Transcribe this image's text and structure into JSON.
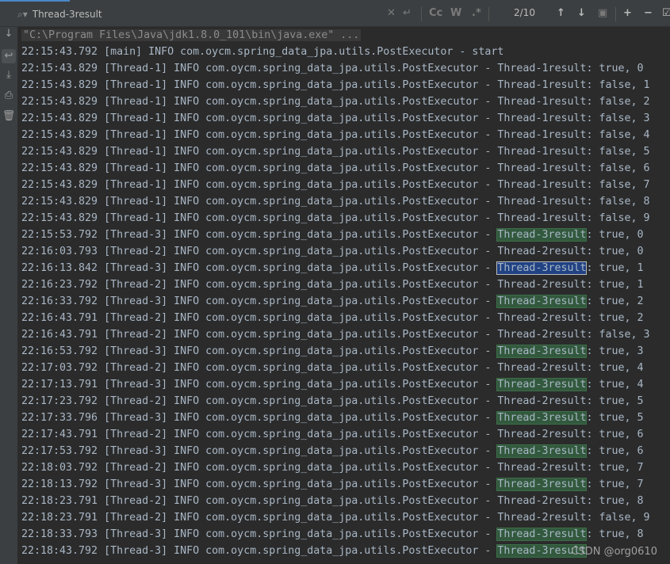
{
  "search": {
    "query": "Thread-3result",
    "match_counter": "2/10",
    "case_label": "Cc",
    "word_label": "W",
    "regex_label": ".*"
  },
  "icons": {
    "search": "search-icon",
    "clear": "close-icon",
    "newline": "enter-icon",
    "up": "arrow-up-icon",
    "down": "arrow-down-icon",
    "select": "select-all-icon",
    "add": "add-occurrence-icon",
    "remove": "remove-occurrence-icon",
    "filter": "filter-icon"
  },
  "colors": {
    "background": "#2b2b2b",
    "text": "#a9b7c6",
    "match": "#32593d",
    "current_match": "#214283"
  },
  "console": {
    "command": "\"C:\\Program Files\\Java\\jdk1.8.0_101\\bin\\java.exe\" ...",
    "lines": [
      {
        "pre": "22:15:43.792 [main] INFO com.oycm.spring_data_jpa.utils.PostExecutor - start",
        "key": "",
        "post": "",
        "mark": ""
      },
      {
        "pre": "22:15:43.829 [Thread-1] INFO com.oycm.spring_data_jpa.utils.PostExecutor - ",
        "key": "Thread-1result",
        "post": ": true, 0",
        "mark": ""
      },
      {
        "pre": "22:15:43.829 [Thread-1] INFO com.oycm.spring_data_jpa.utils.PostExecutor - ",
        "key": "Thread-1result",
        "post": ": false, 1",
        "mark": ""
      },
      {
        "pre": "22:15:43.829 [Thread-1] INFO com.oycm.spring_data_jpa.utils.PostExecutor - ",
        "key": "Thread-1result",
        "post": ": false, 2",
        "mark": ""
      },
      {
        "pre": "22:15:43.829 [Thread-1] INFO com.oycm.spring_data_jpa.utils.PostExecutor - ",
        "key": "Thread-1result",
        "post": ": false, 3",
        "mark": ""
      },
      {
        "pre": "22:15:43.829 [Thread-1] INFO com.oycm.spring_data_jpa.utils.PostExecutor - ",
        "key": "Thread-1result",
        "post": ": false, 4",
        "mark": ""
      },
      {
        "pre": "22:15:43.829 [Thread-1] INFO com.oycm.spring_data_jpa.utils.PostExecutor - ",
        "key": "Thread-1result",
        "post": ": false, 5",
        "mark": ""
      },
      {
        "pre": "22:15:43.829 [Thread-1] INFO com.oycm.spring_data_jpa.utils.PostExecutor - ",
        "key": "Thread-1result",
        "post": ": false, 6",
        "mark": ""
      },
      {
        "pre": "22:15:43.829 [Thread-1] INFO com.oycm.spring_data_jpa.utils.PostExecutor - ",
        "key": "Thread-1result",
        "post": ": false, 7",
        "mark": ""
      },
      {
        "pre": "22:15:43.829 [Thread-1] INFO com.oycm.spring_data_jpa.utils.PostExecutor - ",
        "key": "Thread-1result",
        "post": ": false, 8",
        "mark": ""
      },
      {
        "pre": "22:15:43.829 [Thread-1] INFO com.oycm.spring_data_jpa.utils.PostExecutor - ",
        "key": "Thread-1result",
        "post": ": false, 9",
        "mark": ""
      },
      {
        "pre": "22:15:53.792 [Thread-3] INFO com.oycm.spring_data_jpa.utils.PostExecutor - ",
        "key": "Thread-3result",
        "post": ": true, 0",
        "mark": "hl"
      },
      {
        "pre": "22:16:03.793 [Thread-2] INFO com.oycm.spring_data_jpa.utils.PostExecutor - ",
        "key": "Thread-2result",
        "post": ": true, 0",
        "mark": ""
      },
      {
        "pre": "22:16:13.842 [Thread-3] INFO com.oycm.spring_data_jpa.utils.PostExecutor - ",
        "key": "Thread-3result",
        "post": ": true, 1",
        "mark": "cur"
      },
      {
        "pre": "22:16:23.792 [Thread-2] INFO com.oycm.spring_data_jpa.utils.PostExecutor - ",
        "key": "Thread-2result",
        "post": ": true, 1",
        "mark": ""
      },
      {
        "pre": "22:16:33.792 [Thread-3] INFO com.oycm.spring_data_jpa.utils.PostExecutor - ",
        "key": "Thread-3result",
        "post": ": true, 2",
        "mark": "hl"
      },
      {
        "pre": "22:16:43.791 [Thread-2] INFO com.oycm.spring_data_jpa.utils.PostExecutor - ",
        "key": "Thread-2result",
        "post": ": true, 2",
        "mark": ""
      },
      {
        "pre": "22:16:43.791 [Thread-2] INFO com.oycm.spring_data_jpa.utils.PostExecutor - ",
        "key": "Thread-2result",
        "post": ": false, 3",
        "mark": ""
      },
      {
        "pre": "22:16:53.792 [Thread-3] INFO com.oycm.spring_data_jpa.utils.PostExecutor - ",
        "key": "Thread-3result",
        "post": ": true, 3",
        "mark": "hl"
      },
      {
        "pre": "22:17:03.792 [Thread-2] INFO com.oycm.spring_data_jpa.utils.PostExecutor - ",
        "key": "Thread-2result",
        "post": ": true, 4",
        "mark": ""
      },
      {
        "pre": "22:17:13.791 [Thread-3] INFO com.oycm.spring_data_jpa.utils.PostExecutor - ",
        "key": "Thread-3result",
        "post": ": true, 4",
        "mark": "hl"
      },
      {
        "pre": "22:17:23.792 [Thread-2] INFO com.oycm.spring_data_jpa.utils.PostExecutor - ",
        "key": "Thread-2result",
        "post": ": true, 5",
        "mark": ""
      },
      {
        "pre": "22:17:33.796 [Thread-3] INFO com.oycm.spring_data_jpa.utils.PostExecutor - ",
        "key": "Thread-3result",
        "post": ": true, 5",
        "mark": "hl"
      },
      {
        "pre": "22:17:43.791 [Thread-2] INFO com.oycm.spring_data_jpa.utils.PostExecutor - ",
        "key": "Thread-2result",
        "post": ": true, 6",
        "mark": ""
      },
      {
        "pre": "22:17:53.792 [Thread-3] INFO com.oycm.spring_data_jpa.utils.PostExecutor - ",
        "key": "Thread-3result",
        "post": ": true, 6",
        "mark": "hl"
      },
      {
        "pre": "22:18:03.792 [Thread-2] INFO com.oycm.spring_data_jpa.utils.PostExecutor - ",
        "key": "Thread-2result",
        "post": ": true, 7",
        "mark": ""
      },
      {
        "pre": "22:18:13.792 [Thread-3] INFO com.oycm.spring_data_jpa.utils.PostExecutor - ",
        "key": "Thread-3result",
        "post": ": true, 7",
        "mark": "hl"
      },
      {
        "pre": "22:18:23.791 [Thread-2] INFO com.oycm.spring_data_jpa.utils.PostExecutor - ",
        "key": "Thread-2result",
        "post": ": true, 8",
        "mark": ""
      },
      {
        "pre": "22:18:23.791 [Thread-2] INFO com.oycm.spring_data_jpa.utils.PostExecutor - ",
        "key": "Thread-2result",
        "post": ": false, 9",
        "mark": ""
      },
      {
        "pre": "22:18:33.793 [Thread-3] INFO com.oycm.spring_data_jpa.utils.PostExecutor - ",
        "key": "Thread-3result",
        "post": ": true, 8",
        "mark": "hl"
      },
      {
        "pre": "22:18:43.792 [Thread-3] INFO com.oycm.spring_data_jpa.utils.PostExecutor - ",
        "key": "Thread-3result",
        "post": "",
        "mark": "hl"
      }
    ]
  },
  "watermark": "CSDN @org0610"
}
